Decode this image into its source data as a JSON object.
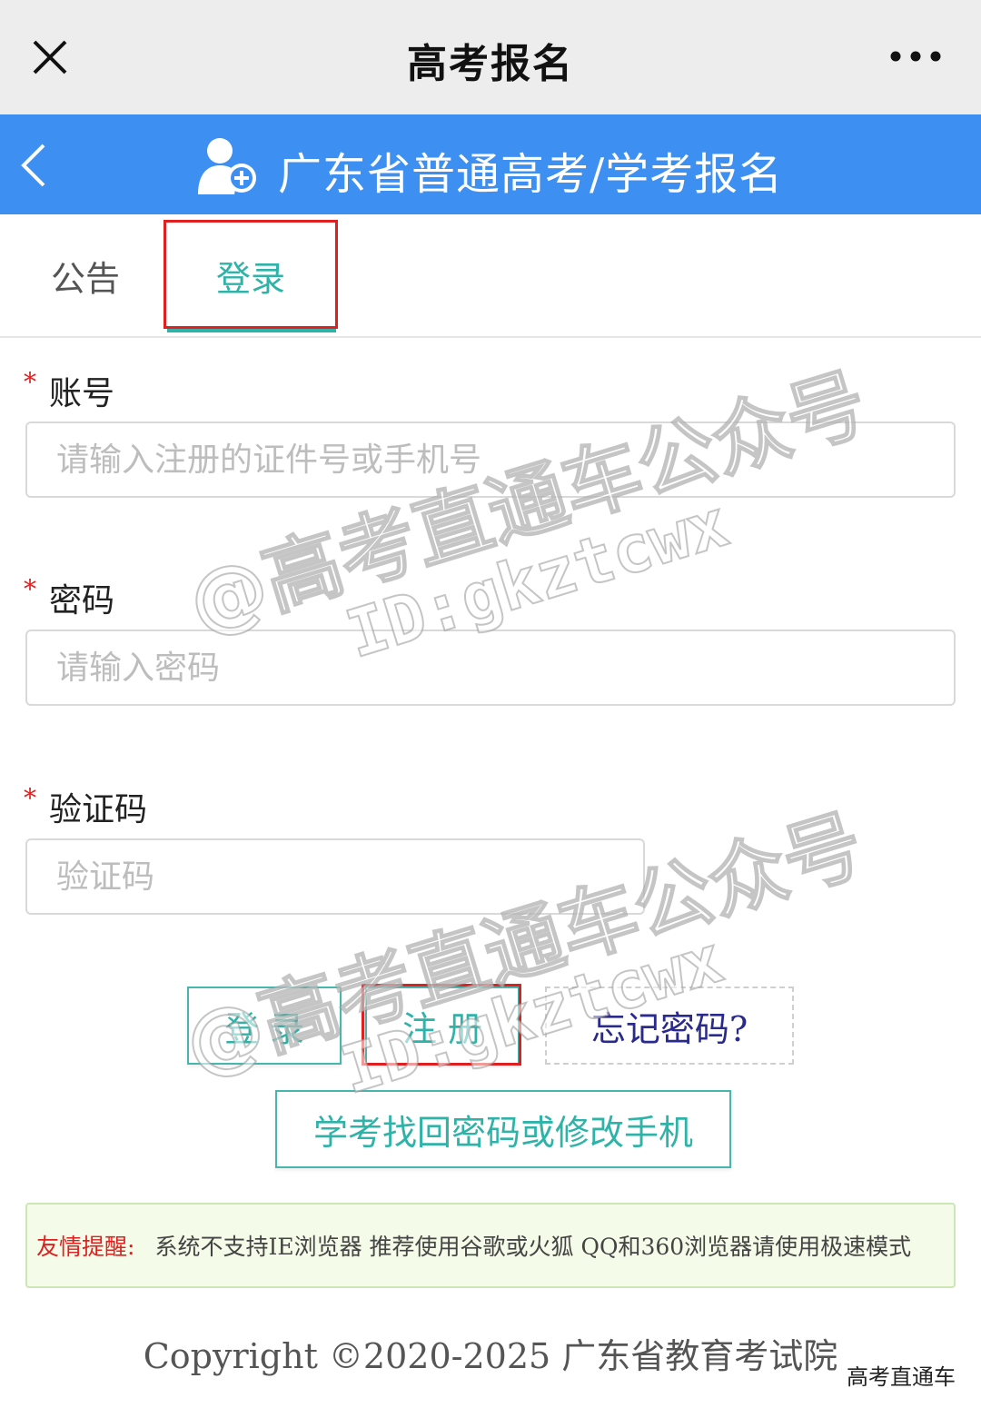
{
  "wechat_bar": {
    "title": "高考报名"
  },
  "header": {
    "title": "广东省普通高考/学考报名"
  },
  "tabs": [
    {
      "label": "公告"
    },
    {
      "label": "登录"
    }
  ],
  "form": {
    "account": {
      "label": "账号",
      "placeholder": "请输入注册的证件号或手机号"
    },
    "password": {
      "label": "密码",
      "placeholder": "请输入密码"
    },
    "captcha": {
      "label": "验证码",
      "placeholder": "验证码"
    }
  },
  "buttons": {
    "login": "登 录",
    "register": "注 册",
    "forgot": "忘记密码?",
    "recover": "学考找回密码或修改手机"
  },
  "tip": {
    "label": "友情提醒:",
    "text": "系统不支持IE浏览器 推荐使用谷歌或火狐 QQ和360浏览器请使用极速模式"
  },
  "footer": {
    "copyright": "Copyright ©2020-2025 广东省教育考试院",
    "corner_watermark": "高考直通车"
  },
  "watermark": {
    "line1": "@高考直通车公众号",
    "line2": "ID:gkztcwx"
  },
  "colors": {
    "header_blue": "#3d8ff2",
    "accent_teal": "#2fb3a8",
    "highlight_red": "#e02020"
  }
}
